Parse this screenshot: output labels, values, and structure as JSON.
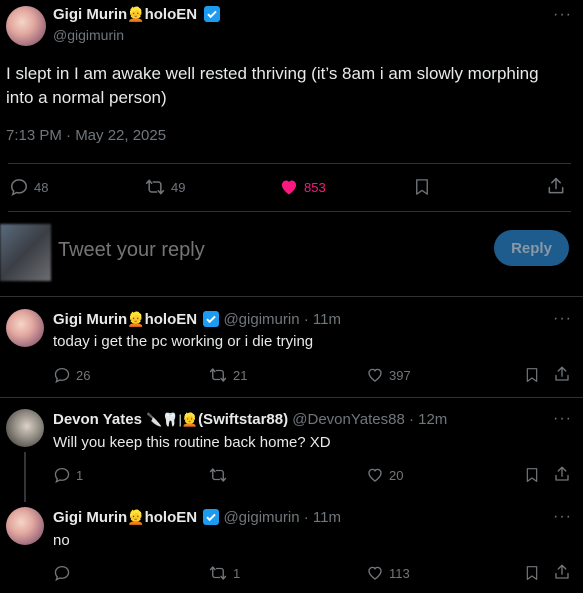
{
  "main_tweet": {
    "display_name": "Gigi Murin",
    "name_suffix": "holoEN",
    "handle": "@gigimurin",
    "text": "I slept in I am awake well rested thriving (it’s 8am i am slowly morphing into a normal person)",
    "timestamp": "7:13 PM · May 22, 2025",
    "reply_count": "48",
    "retweet_count": "49",
    "like_count": "853",
    "more": "···"
  },
  "composer": {
    "placeholder": "Tweet your reply",
    "button_label": "Reply"
  },
  "replies": [
    {
      "display_name": "Gigi Murin",
      "name_suffix": "holoEN",
      "handle": "@gigimurin",
      "time": "· 11m",
      "text": "today i get the pc working or i die trying",
      "reply_count": "26",
      "retweet_count": "21",
      "like_count": "397",
      "more": "···"
    },
    {
      "display_name": "Devon Yates",
      "name_suffix": "(Swiftstar88)",
      "handle": "@DevonYates88",
      "time": "· 12m",
      "text": "Will you keep this routine back home? XD",
      "reply_count": "1",
      "retweet_count": "",
      "like_count": "20",
      "more": "···"
    },
    {
      "display_name": "Gigi Murin",
      "name_suffix": "holoEN",
      "handle": "@gigimurin",
      "time": "· 11m",
      "text": "no",
      "reply_count": "",
      "retweet_count": "1",
      "like_count": "113",
      "more": "···"
    }
  ],
  "colors": {
    "background": "#000000",
    "text": "#e7e9ea",
    "muted": "#71767b",
    "like_active": "#f91880",
    "verified": "#1d9bf0",
    "reply_button": "#1d5c8c"
  },
  "icons": [
    "reply-icon",
    "retweet-icon",
    "heart-icon",
    "bookmark-icon",
    "share-icon",
    "verified-icon",
    "emoji-icon",
    "more-icon"
  ]
}
